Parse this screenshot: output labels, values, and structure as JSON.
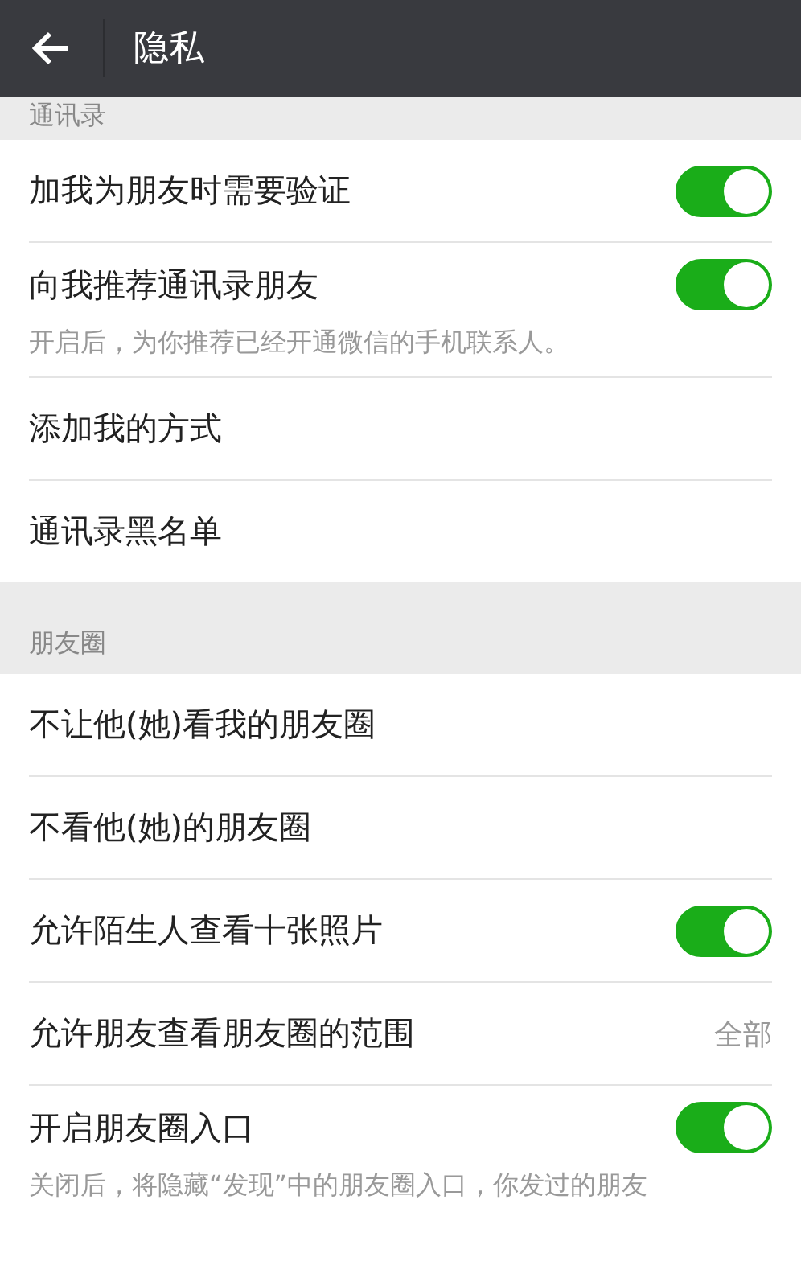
{
  "header": {
    "title": "隐私"
  },
  "sections": [
    {
      "title": "通讯录",
      "items": [
        {
          "kind": "toggle",
          "label": "加我为朋友时需要验证",
          "on": true
        },
        {
          "kind": "toggle",
          "label": "向我推荐通讯录朋友",
          "on": true,
          "description": "开启后，为你推荐已经开通微信的手机联系人。"
        },
        {
          "kind": "link",
          "label": "添加我的方式"
        },
        {
          "kind": "link",
          "label": "通讯录黑名单"
        }
      ]
    },
    {
      "title": "朋友圈",
      "items": [
        {
          "kind": "link",
          "label": "不让他(她)看我的朋友圈"
        },
        {
          "kind": "link",
          "label": "不看他(她)的朋友圈"
        },
        {
          "kind": "toggle",
          "label": "允许陌生人查看十张照片",
          "on": true
        },
        {
          "kind": "link",
          "label": "允许朋友查看朋友圈的范围",
          "value": "全部"
        },
        {
          "kind": "toggle",
          "label": "开启朋友圈入口",
          "on": true,
          "description": "关闭后，将隐藏“发现”中的朋友圈入口，你发过的朋友"
        }
      ]
    }
  ]
}
